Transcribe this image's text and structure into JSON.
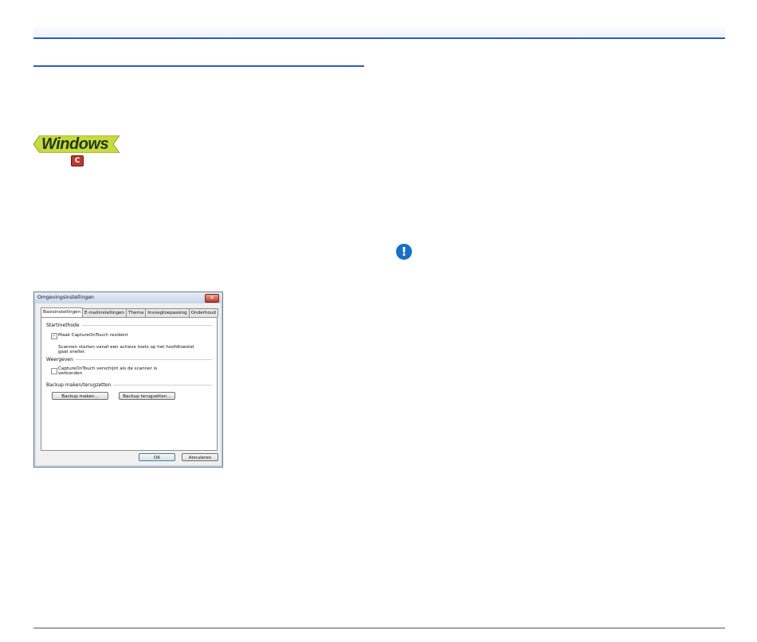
{
  "windows_badge": {
    "text": "Windows"
  },
  "dialog": {
    "title": "Omgevingsinstellingen",
    "close_glyph": "✕",
    "tabs": [
      "Basisinstellingen",
      "E-mailinstellingen",
      "Thema",
      "Invoegtoepassing",
      "Onderhoud"
    ],
    "groups": {
      "startmethode": {
        "label": "Startmethode",
        "checkbox_label": "Maak CaptureOnTouch resident",
        "checked": true,
        "description_line1": "Scannen starten vanaf een actieve toets op het hoofdtoestel",
        "description_line2": "gaat sneller."
      },
      "weergeven": {
        "label": "Weergeven",
        "checkbox_label_line1": "CaptureOnTouch verschijnt als de scanner is",
        "checkbox_label_line2": "verbonden",
        "checked": false
      },
      "backup": {
        "label": "Backup maken/terugzetten",
        "make_button": "Backup maken...",
        "restore_button": "Backup terugzetten..."
      }
    },
    "ok_button": "OK",
    "cancel_button": "Annuleren"
  },
  "colors": {
    "accent_blue": "#2a5fb8",
    "badge_green": "#c9d940",
    "important_blue": "#1a6fc9"
  },
  "icons": {
    "small_red": "capture-on-touch-icon",
    "important": "exclamation-icon"
  }
}
